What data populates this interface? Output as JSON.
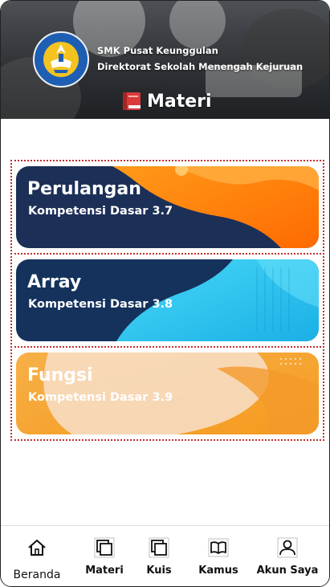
{
  "header": {
    "org_line1": "SMK Pusat Keunggulan",
    "org_line2": "Direktorat Sekolah Menengah Kejuruan",
    "page_title": "Materi",
    "logo_text": "TUT WURI HANDAYANI"
  },
  "cards": [
    {
      "title": "Perulangan",
      "subtitle": "Kompetensi Dasar 3.7"
    },
    {
      "title": "Array",
      "subtitle": "Kompetensi Dasar 3.8"
    },
    {
      "title": "Fungsi",
      "subtitle": "Kompetensi Dasar 3.9"
    }
  ],
  "nav": {
    "items": [
      {
        "label": "Beranda",
        "icon": "home-icon"
      },
      {
        "label": "Materi",
        "icon": "pages-icon"
      },
      {
        "label": "Kuis",
        "icon": "pages-icon"
      },
      {
        "label": "Kamus",
        "icon": "book-icon"
      },
      {
        "label": "Akun Saya",
        "icon": "user-icon"
      }
    ]
  },
  "colors": {
    "card1_dark": "#1c2f57",
    "card1_accent": "#ff8a00",
    "card2_dark": "#14325c",
    "card2_accent": "#36c9f0",
    "card3_accent": "#f7a12a",
    "card3_light": "#f7ddc2",
    "selection_border": "#c0302e"
  }
}
